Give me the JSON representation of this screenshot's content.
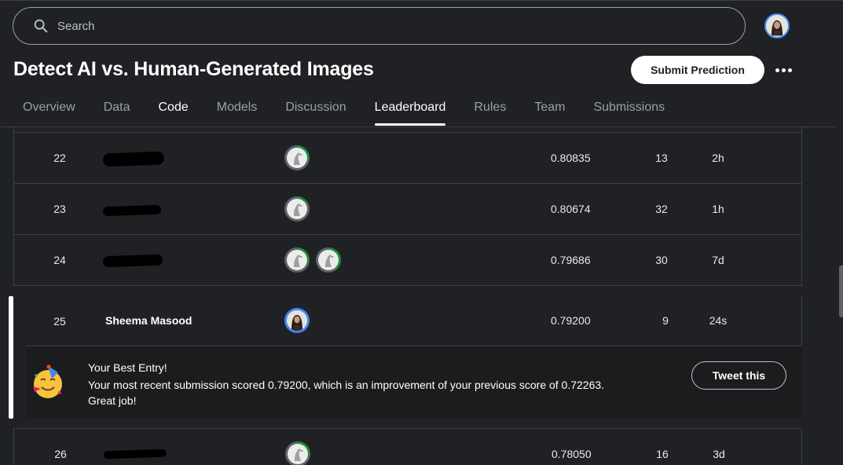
{
  "search": {
    "placeholder": "Search"
  },
  "header": {
    "title": "Detect AI vs. Human-Generated Images",
    "submit_label": "Submit Prediction"
  },
  "tabs": [
    {
      "label": "Overview"
    },
    {
      "label": "Data"
    },
    {
      "label": "Code"
    },
    {
      "label": "Models"
    },
    {
      "label": "Discussion"
    },
    {
      "label": "Leaderboard"
    },
    {
      "label": "Rules"
    },
    {
      "label": "Team"
    },
    {
      "label": "Submissions"
    }
  ],
  "rows": [
    {
      "rank": "22",
      "score": "0.80835",
      "entries": "13",
      "last": "2h"
    },
    {
      "rank": "23",
      "score": "0.80674",
      "entries": "32",
      "last": "1h"
    },
    {
      "rank": "24",
      "score": "0.79686",
      "entries": "30",
      "last": "7d"
    }
  ],
  "me": {
    "rank": "25",
    "name": "Sheema Masood",
    "score": "0.79200",
    "entries": "9",
    "last": "24s"
  },
  "best_entry": {
    "title": "Your Best Entry!",
    "message": "Your most recent submission scored 0.79200, which is an improvement of your previous score of 0.72263. Great job!",
    "tweet_label": "Tweet this"
  },
  "row26": {
    "rank": "26",
    "score": "0.78050",
    "entries": "16",
    "last": "3d"
  },
  "colors": {
    "background": "#202124",
    "accent_ring": "#1e8e3e",
    "me_ring": "#4285f4"
  }
}
